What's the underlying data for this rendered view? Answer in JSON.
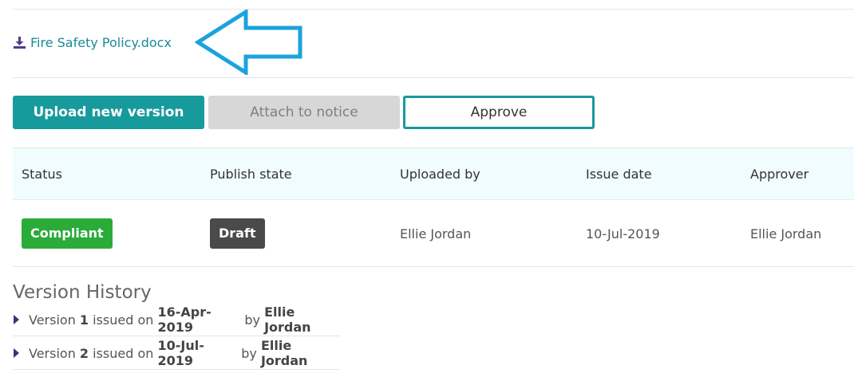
{
  "document": {
    "file_name": "Fire Safety Policy.docx",
    "download_icon": "download-icon",
    "annotation_icon": "left-arrow-annotation"
  },
  "actions": {
    "upload_label": "Upload new version",
    "attach_label": "Attach to notice",
    "approve_label": "Approve"
  },
  "table": {
    "headers": [
      "Status",
      "Publish state",
      "Uploaded by",
      "Issue date",
      "Approver"
    ],
    "row": {
      "status": "Compliant",
      "publish_state": "Draft",
      "uploaded_by": "Ellie Jordan",
      "issue_date": "10-Jul-2019",
      "approver": "Ellie Jordan"
    }
  },
  "version_history": {
    "title": "Version History",
    "items": [
      {
        "prefix": "Version ",
        "number": "1",
        "middle": " issued on ",
        "date": "16-Apr-2019",
        "by": " by ",
        "user": "Ellie Jordan"
      },
      {
        "prefix": "Version ",
        "number": "2",
        "middle": " issued on ",
        "date": "10-Jul-2019",
        "by": " by ",
        "user": "Ellie Jordan"
      }
    ]
  },
  "colors": {
    "accent": "#179a9c",
    "link": "#1a8c96",
    "compliant": "#2bab3a",
    "draft": "#4a4a4a",
    "annotation": "#1aa3dc"
  }
}
